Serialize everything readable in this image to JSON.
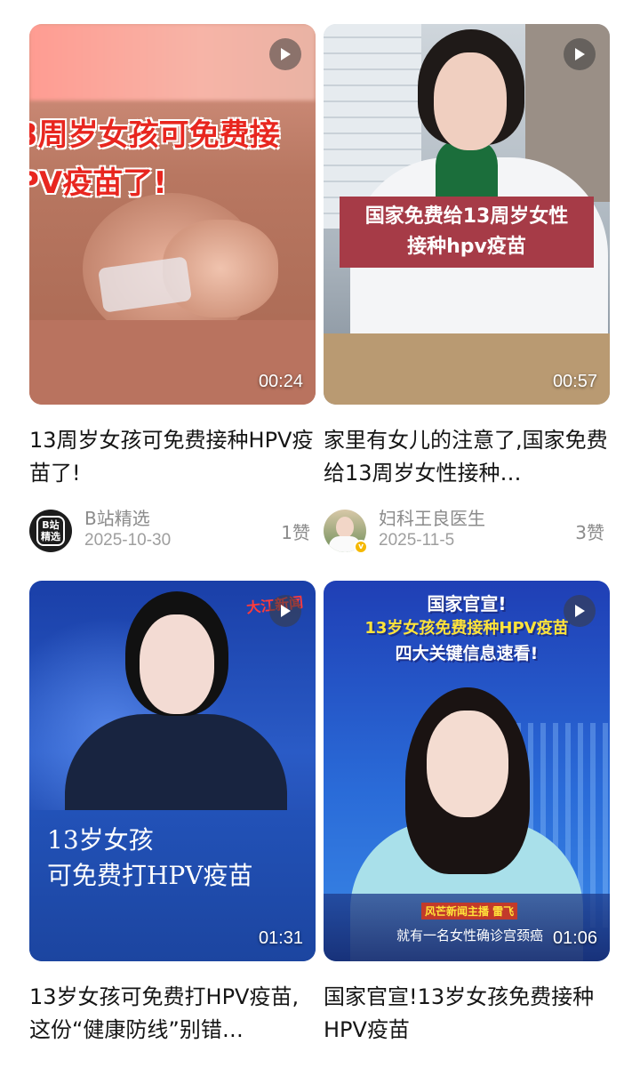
{
  "feed": {
    "cards": [
      {
        "thumb_text": "3周岁女孩可免费接\nPV疫苗了!",
        "duration": "00:24",
        "title": "13周岁女孩可免费接种HPV疫苗了!",
        "author": "B站精选",
        "avatar_text": "B站\n精选",
        "date": "2025-10-30",
        "likes": "1赞"
      },
      {
        "thumb_text": "国家免费给13周岁女性\n接种hpv疫苗",
        "duration": "00:57",
        "title": "家里有女儿的注意了,国家免费给13周岁女性接种…",
        "author": "妇科王良医生",
        "verified": true,
        "date": "2025-11-5",
        "likes": "3赞"
      },
      {
        "thumb_logo": "大江新闻",
        "thumb_text": "13岁女孩\n可免费打HPV疫苗",
        "duration": "01:31",
        "title": "13岁女孩可免费打HPV疫苗,这份“健康防线”别错…"
      },
      {
        "headline_1": "国家官宣!",
        "headline_2": "13岁女孩免费接种HPV疫苗",
        "headline_3": "四大关键信息速看!",
        "reporter_tag": "风芒新闻主播 雷飞",
        "subtitle": "就有一名女性确诊宫颈癌",
        "duration": "01:06",
        "title": "国家官宣!13岁女孩免费接种HPV疫苗"
      }
    ]
  },
  "colors": {
    "title_text": "#151515",
    "meta_text": "#8b8b8b",
    "thumb2_banner": "#a63b47",
    "thumb4_headline_highlight": "#ffe43a"
  },
  "icons": [
    "play-icon",
    "verified-badge-icon"
  ]
}
